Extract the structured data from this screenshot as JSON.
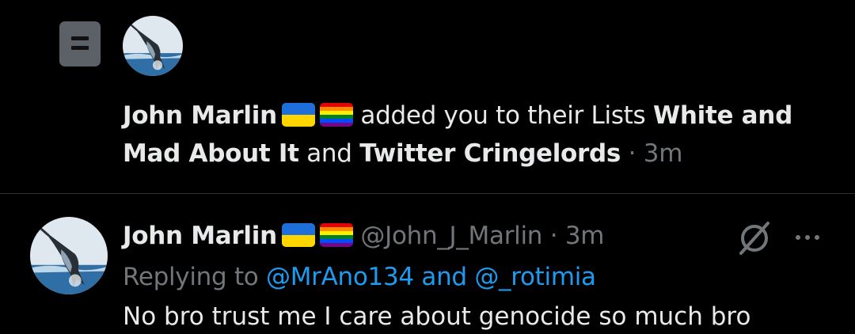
{
  "notification": {
    "icon": "list-icon",
    "author": "John Marlin",
    "flags": [
      "ukraine-flag",
      "rainbow-flag"
    ],
    "text_before": "added you to their Lists",
    "list1": "White and Mad About It",
    "connector": "and",
    "list2": "Twitter Cringelords",
    "separator": "·",
    "time": "3m"
  },
  "tweet": {
    "author": "John Marlin",
    "handle": "@John_J_Marlin",
    "separator": "·",
    "time": "3m",
    "replying_prefix": "Replying to",
    "replying_to": "@MrAno134 and @_rotimia",
    "body_partial": "No bro trust me I care about genocide so much bro"
  },
  "colors": {
    "background": "#000000",
    "text": "#e7e9ea",
    "muted": "#71767b",
    "link": "#1d9bf0",
    "divider": "#2f3336"
  }
}
